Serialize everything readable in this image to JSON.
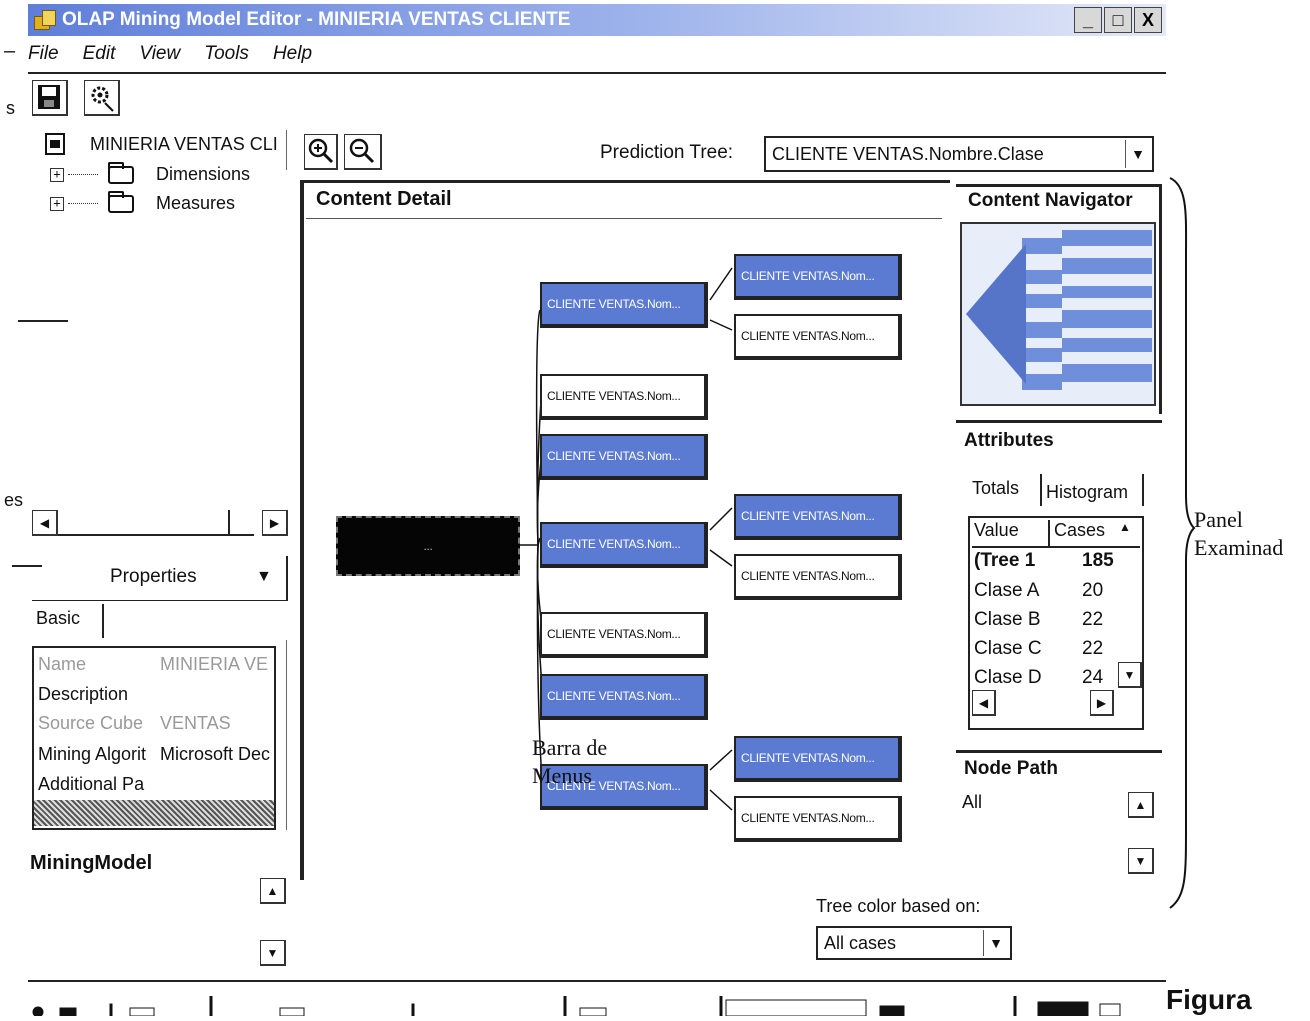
{
  "window": {
    "title": "OLAP Mining Model Editor - MINIERIA VENTAS CLIENTE",
    "buttons": [
      "_",
      "□",
      "X"
    ]
  },
  "menu": [
    "File",
    "Edit",
    "View",
    "Tools",
    "Help"
  ],
  "toolbar": [
    "save-icon",
    "process-icon"
  ],
  "left_edge_fragments": [
    "–",
    "s",
    "es"
  ],
  "tree": {
    "root": "MINIERIA VENTAS CLI",
    "children": [
      "Dimensions",
      "Measures"
    ],
    "expand_glyph": "+"
  },
  "properties": {
    "header": "Properties",
    "tab": "Basic",
    "rows": [
      {
        "key": "Name",
        "value": "MINIERIA VE",
        "dim": true
      },
      {
        "key": "Description",
        "value": "",
        "dim": false
      },
      {
        "key": "Source Cube",
        "value": "VENTAS",
        "dim": true
      },
      {
        "key": "Mining Algorit",
        "value": "Microsoft Dec",
        "dim": false
      },
      {
        "key": "Additional Pa",
        "value": "",
        "dim": false
      }
    ],
    "description_title": "MiningModel"
  },
  "prediction": {
    "label": "Prediction Tree:",
    "value": "CLIENTE VENTAS.Nombre.Clase"
  },
  "content_detail": {
    "title": "Content Detail",
    "root_label": "...",
    "node_label": "CLIENTE VENTAS.Nom..."
  },
  "navigator": {
    "title": "Content Navigator"
  },
  "attributes": {
    "title": "Attributes",
    "tabs": [
      "Totals",
      "Histogram"
    ],
    "columns": [
      "Value",
      "Cases"
    ],
    "rows": [
      {
        "value": "(Tree 1",
        "cases": "185"
      },
      {
        "value": "Clase A",
        "cases": "20"
      },
      {
        "value": "Clase B",
        "cases": "22"
      },
      {
        "value": "Clase C",
        "cases": "22"
      },
      {
        "value": "Clase D",
        "cases": "24"
      }
    ]
  },
  "node_path": {
    "title": "Node Path",
    "value": "All"
  },
  "tree_color": {
    "label": "Tree color based on:",
    "value": "All cases"
  },
  "annotations": {
    "panel": "Panel Examinad",
    "menus": "Barra de Menus",
    "figure": "Figura"
  }
}
